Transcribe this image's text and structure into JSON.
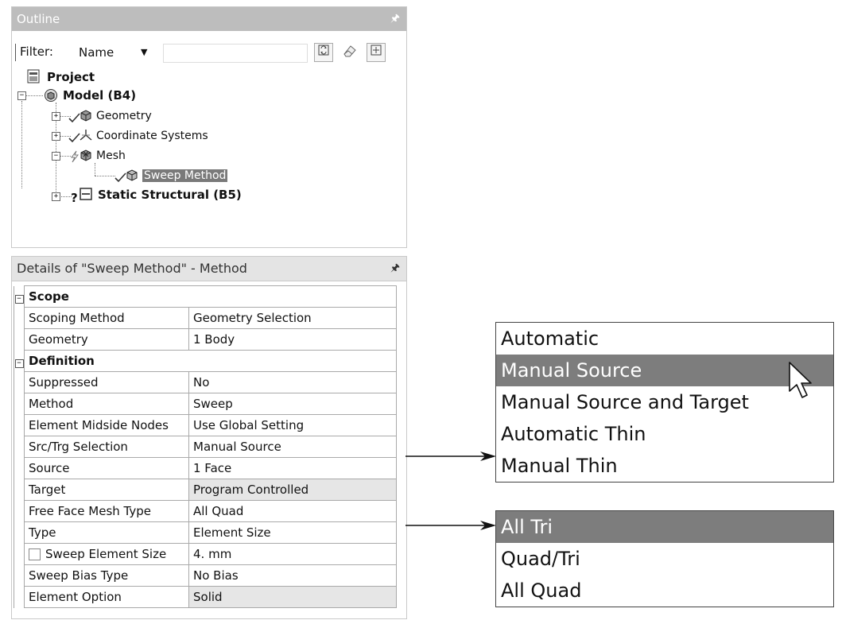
{
  "outline": {
    "title": "Outline",
    "pin": "4",
    "filter_label": "Filter:",
    "filter_value": "Name",
    "filter_input": "",
    "tree": {
      "project": "Project",
      "model": "Model (B4)",
      "geometry": "Geometry",
      "coordinate_systems": "Coordinate Systems",
      "mesh": "Mesh",
      "sweep_method": "Sweep Method",
      "static_structural": "Static Structural (B5)"
    }
  },
  "details": {
    "title": "Details of \"Sweep Method\" - Method",
    "rows": [
      {
        "type": "section",
        "label": "Scope"
      },
      {
        "type": "prop",
        "label": "Scoping Method",
        "value": "Geometry Selection"
      },
      {
        "type": "prop",
        "label": "Geometry",
        "value": "1 Body"
      },
      {
        "type": "section",
        "label": "Definition"
      },
      {
        "type": "prop",
        "label": "Suppressed",
        "value": "No"
      },
      {
        "type": "prop",
        "label": "Method",
        "value": "Sweep"
      },
      {
        "type": "prop",
        "label": "Element Midside Nodes",
        "value": "Use Global Setting"
      },
      {
        "type": "prop",
        "label": "Src/Trg Selection",
        "value": "Manual Source"
      },
      {
        "type": "prop",
        "label": "Source",
        "value": "1 Face"
      },
      {
        "type": "prop",
        "label": "Target",
        "value": "Program Controlled",
        "shaded": true
      },
      {
        "type": "prop",
        "label": "Free Face Mesh Type",
        "value": "All Quad"
      },
      {
        "type": "prop",
        "label": "Type",
        "value": "Element Size"
      },
      {
        "type": "prop",
        "label": "Sweep Element Size",
        "value": "4. mm",
        "checkbox": true
      },
      {
        "type": "prop",
        "label": "Sweep Bias Type",
        "value": "No Bias"
      },
      {
        "type": "prop",
        "label": "Element Option",
        "value": "Solid",
        "shaded": true
      }
    ]
  },
  "src_trg_dropdown": {
    "options": [
      "Automatic",
      "Manual Source",
      "Manual Source and Target",
      "Automatic Thin",
      "Manual Thin"
    ],
    "highlighted": 1
  },
  "face_mesh_dropdown": {
    "options": [
      "All Tri",
      "Quad/Tri",
      "All Quad"
    ],
    "highlighted": 0
  },
  "colors": {
    "header_bg": "#bdbdbd",
    "highlight_bg": "#7d7d7d",
    "shaded_cell": "#e6e6e6"
  }
}
